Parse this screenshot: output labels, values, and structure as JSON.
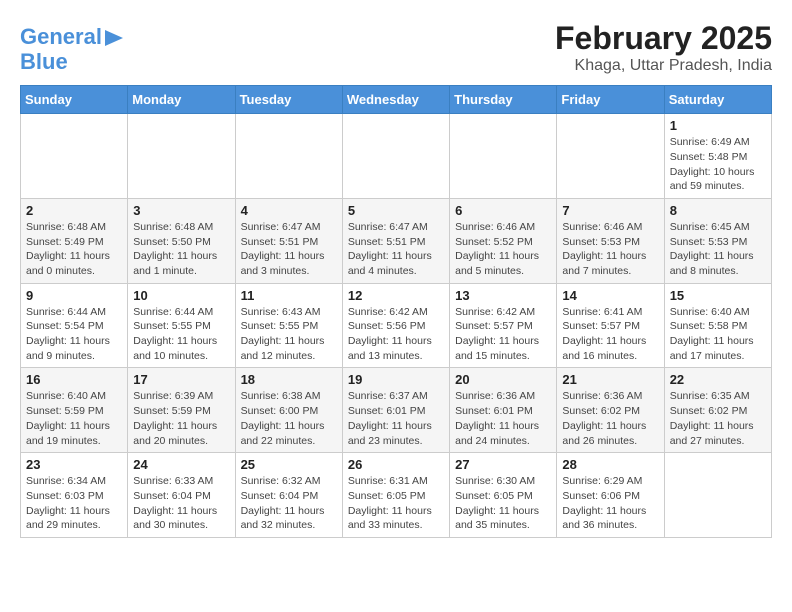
{
  "header": {
    "logo_line1": "General",
    "logo_line2": "Blue",
    "month": "February 2025",
    "location": "Khaga, Uttar Pradesh, India"
  },
  "weekdays": [
    "Sunday",
    "Monday",
    "Tuesday",
    "Wednesday",
    "Thursday",
    "Friday",
    "Saturday"
  ],
  "weeks": [
    [
      {
        "day": "",
        "info": ""
      },
      {
        "day": "",
        "info": ""
      },
      {
        "day": "",
        "info": ""
      },
      {
        "day": "",
        "info": ""
      },
      {
        "day": "",
        "info": ""
      },
      {
        "day": "",
        "info": ""
      },
      {
        "day": "1",
        "info": "Sunrise: 6:49 AM\nSunset: 5:48 PM\nDaylight: 10 hours\nand 59 minutes."
      }
    ],
    [
      {
        "day": "2",
        "info": "Sunrise: 6:48 AM\nSunset: 5:49 PM\nDaylight: 11 hours\nand 0 minutes."
      },
      {
        "day": "3",
        "info": "Sunrise: 6:48 AM\nSunset: 5:50 PM\nDaylight: 11 hours\nand 1 minute."
      },
      {
        "day": "4",
        "info": "Sunrise: 6:47 AM\nSunset: 5:51 PM\nDaylight: 11 hours\nand 3 minutes."
      },
      {
        "day": "5",
        "info": "Sunrise: 6:47 AM\nSunset: 5:51 PM\nDaylight: 11 hours\nand 4 minutes."
      },
      {
        "day": "6",
        "info": "Sunrise: 6:46 AM\nSunset: 5:52 PM\nDaylight: 11 hours\nand 5 minutes."
      },
      {
        "day": "7",
        "info": "Sunrise: 6:46 AM\nSunset: 5:53 PM\nDaylight: 11 hours\nand 7 minutes."
      },
      {
        "day": "8",
        "info": "Sunrise: 6:45 AM\nSunset: 5:53 PM\nDaylight: 11 hours\nand 8 minutes."
      }
    ],
    [
      {
        "day": "9",
        "info": "Sunrise: 6:44 AM\nSunset: 5:54 PM\nDaylight: 11 hours\nand 9 minutes."
      },
      {
        "day": "10",
        "info": "Sunrise: 6:44 AM\nSunset: 5:55 PM\nDaylight: 11 hours\nand 10 minutes."
      },
      {
        "day": "11",
        "info": "Sunrise: 6:43 AM\nSunset: 5:55 PM\nDaylight: 11 hours\nand 12 minutes."
      },
      {
        "day": "12",
        "info": "Sunrise: 6:42 AM\nSunset: 5:56 PM\nDaylight: 11 hours\nand 13 minutes."
      },
      {
        "day": "13",
        "info": "Sunrise: 6:42 AM\nSunset: 5:57 PM\nDaylight: 11 hours\nand 15 minutes."
      },
      {
        "day": "14",
        "info": "Sunrise: 6:41 AM\nSunset: 5:57 PM\nDaylight: 11 hours\nand 16 minutes."
      },
      {
        "day": "15",
        "info": "Sunrise: 6:40 AM\nSunset: 5:58 PM\nDaylight: 11 hours\nand 17 minutes."
      }
    ],
    [
      {
        "day": "16",
        "info": "Sunrise: 6:40 AM\nSunset: 5:59 PM\nDaylight: 11 hours\nand 19 minutes."
      },
      {
        "day": "17",
        "info": "Sunrise: 6:39 AM\nSunset: 5:59 PM\nDaylight: 11 hours\nand 20 minutes."
      },
      {
        "day": "18",
        "info": "Sunrise: 6:38 AM\nSunset: 6:00 PM\nDaylight: 11 hours\nand 22 minutes."
      },
      {
        "day": "19",
        "info": "Sunrise: 6:37 AM\nSunset: 6:01 PM\nDaylight: 11 hours\nand 23 minutes."
      },
      {
        "day": "20",
        "info": "Sunrise: 6:36 AM\nSunset: 6:01 PM\nDaylight: 11 hours\nand 24 minutes."
      },
      {
        "day": "21",
        "info": "Sunrise: 6:36 AM\nSunset: 6:02 PM\nDaylight: 11 hours\nand 26 minutes."
      },
      {
        "day": "22",
        "info": "Sunrise: 6:35 AM\nSunset: 6:02 PM\nDaylight: 11 hours\nand 27 minutes."
      }
    ],
    [
      {
        "day": "23",
        "info": "Sunrise: 6:34 AM\nSunset: 6:03 PM\nDaylight: 11 hours\nand 29 minutes."
      },
      {
        "day": "24",
        "info": "Sunrise: 6:33 AM\nSunset: 6:04 PM\nDaylight: 11 hours\nand 30 minutes."
      },
      {
        "day": "25",
        "info": "Sunrise: 6:32 AM\nSunset: 6:04 PM\nDaylight: 11 hours\nand 32 minutes."
      },
      {
        "day": "26",
        "info": "Sunrise: 6:31 AM\nSunset: 6:05 PM\nDaylight: 11 hours\nand 33 minutes."
      },
      {
        "day": "27",
        "info": "Sunrise: 6:30 AM\nSunset: 6:05 PM\nDaylight: 11 hours\nand 35 minutes."
      },
      {
        "day": "28",
        "info": "Sunrise: 6:29 AM\nSunset: 6:06 PM\nDaylight: 11 hours\nand 36 minutes."
      },
      {
        "day": "",
        "info": ""
      }
    ]
  ]
}
